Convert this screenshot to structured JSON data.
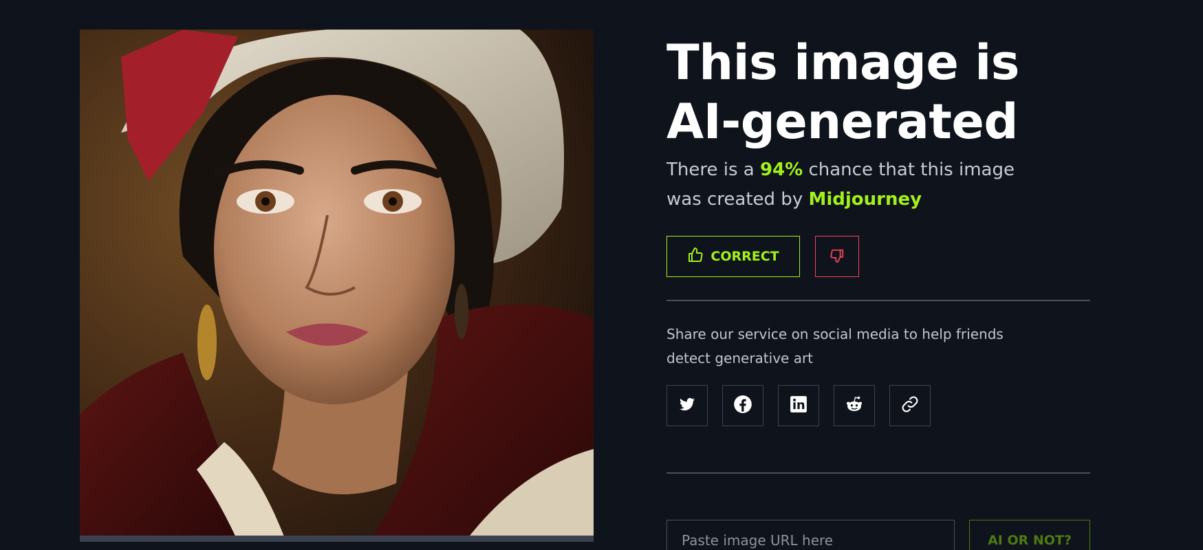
{
  "result": {
    "title": "This image is AI-generated",
    "subtitle_prefix": "There is a ",
    "probability": "94%",
    "subtitle_middle": " chance that this image was created by ",
    "generator": "Midjourney"
  },
  "feedback": {
    "correct_label": "CORRECT",
    "correct_icon": "thumbs-up-icon",
    "wrong_icon": "thumbs-down-icon"
  },
  "share": {
    "text": "Share our service on social media to help friends detect generative art",
    "buttons": [
      {
        "name": "twitter",
        "icon": "twitter-icon"
      },
      {
        "name": "facebook",
        "icon": "facebook-icon"
      },
      {
        "name": "linkedin",
        "icon": "linkedin-icon"
      },
      {
        "name": "reddit",
        "icon": "reddit-icon"
      },
      {
        "name": "copy-link",
        "icon": "link-icon"
      }
    ]
  },
  "check": {
    "placeholder": "Paste image URL here",
    "submit_label": "AI OR NOT?"
  },
  "colors": {
    "background": "#0f131b",
    "accent": "#a3f11c",
    "danger": "#f0455b",
    "text_muted": "#c9ccd3"
  }
}
